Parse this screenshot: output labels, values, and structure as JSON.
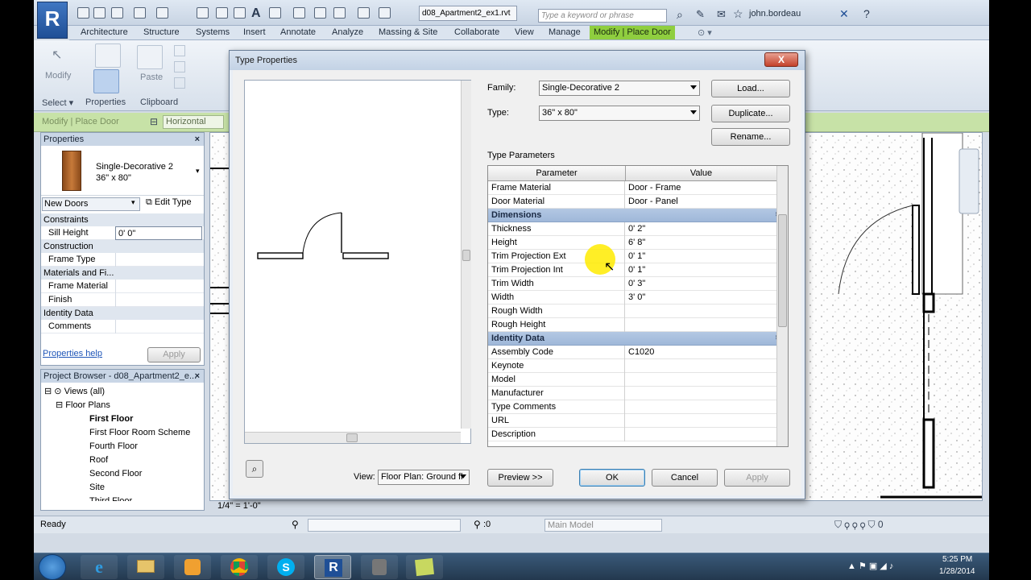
{
  "app": {
    "file_tab": "d08_Apartment2_ex1.rvt",
    "search_placeholder": "Type a keyword or phrase",
    "user": "john.bordeau",
    "logo": "R"
  },
  "ribbon": {
    "tabs": [
      "Architecture",
      "Structure",
      "Systems",
      "Insert",
      "Annotate",
      "Analyze",
      "Massing & Site",
      "Collaborate",
      "View",
      "Manage",
      "Modify | Place Door"
    ],
    "active_tab": "Modify | Place Door",
    "buttons": {
      "modify": "Modify",
      "paste": "Paste"
    },
    "panels": [
      "Select ▾",
      "Properties",
      "Clipboard"
    ]
  },
  "options_bar": {
    "context": "Modify | Place Door",
    "orientation": "Horizontal"
  },
  "properties": {
    "title": "Properties",
    "family": "Single-Decorative 2",
    "type": "36\" x 80\"",
    "filter": "New Doors",
    "edit_type": "Edit Type",
    "groups": [
      {
        "name": "Constraints",
        "rows": [
          {
            "label": "Sill Height",
            "value": "0' 0\""
          }
        ]
      },
      {
        "name": "Construction",
        "rows": [
          {
            "label": "Frame Type",
            "value": ""
          }
        ]
      },
      {
        "name": "Materials and Fi...",
        "rows": [
          {
            "label": "Frame Material",
            "value": ""
          },
          {
            "label": "Finish",
            "value": ""
          }
        ]
      },
      {
        "name": "Identity Data",
        "rows": [
          {
            "label": "Comments",
            "value": ""
          }
        ]
      }
    ],
    "help": "Properties help",
    "apply": "Apply"
  },
  "project_browser": {
    "title": "Project Browser - d08_Apartment2_e...",
    "root": "Views (all)",
    "group": "Floor Plans",
    "items": [
      "First Floor",
      "First Floor Room Scheme",
      "Fourth Floor",
      "Roof",
      "Second Floor",
      "Site",
      "Third Floor"
    ]
  },
  "view_scale": "1/4\" = 1'-0\"",
  "status": {
    "text": "Ready",
    "coord": ":0",
    "model": "Main Model"
  },
  "taskbar": {
    "time": "5:25 PM",
    "date": "1/28/2014"
  },
  "dialog": {
    "title": "Type Properties",
    "close": "X",
    "family_label": "Family:",
    "family_value": "Single-Decorative 2",
    "type_label": "Type:",
    "type_value": "36\" x 80\"",
    "load": "Load...",
    "duplicate": "Duplicate...",
    "rename": "Rename...",
    "type_params_label": "Type Parameters",
    "col_param": "Parameter",
    "col_value": "Value",
    "rows": [
      {
        "param": "Frame Material",
        "value": "Door - Frame"
      },
      {
        "param": "Door Material",
        "value": "Door - Panel"
      }
    ],
    "groups": [
      {
        "name": "Dimensions",
        "rows": [
          {
            "param": "Thickness",
            "value": "0' 2\""
          },
          {
            "param": "Height",
            "value": "6' 8\""
          },
          {
            "param": "Trim Projection Ext",
            "value": "0' 1\""
          },
          {
            "param": "Trim Projection Int",
            "value": "0' 1\""
          },
          {
            "param": "Trim Width",
            "value": "0' 3\""
          },
          {
            "param": "Width",
            "value": "3' 0\""
          },
          {
            "param": "Rough Width",
            "value": ""
          },
          {
            "param": "Rough Height",
            "value": ""
          }
        ]
      },
      {
        "name": "Identity Data",
        "rows": [
          {
            "param": "Assembly Code",
            "value": "C1020"
          },
          {
            "param": "Keynote",
            "value": ""
          },
          {
            "param": "Model",
            "value": ""
          },
          {
            "param": "Manufacturer",
            "value": ""
          },
          {
            "param": "Type Comments",
            "value": ""
          },
          {
            "param": "URL",
            "value": ""
          },
          {
            "param": "Description",
            "value": ""
          }
        ]
      }
    ],
    "view_label": "View:",
    "view_value": "Floor Plan: Ground fl",
    "preview_btn": "Preview >>",
    "ok": "OK",
    "cancel": "Cancel",
    "apply": "Apply"
  }
}
